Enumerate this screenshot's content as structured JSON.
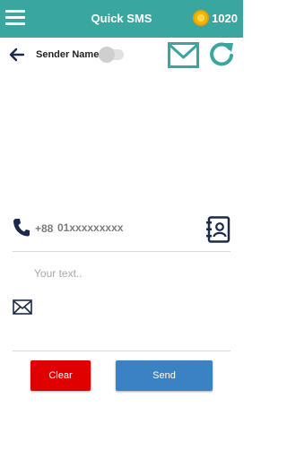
{
  "appbar": {
    "title": "Quick SMS",
    "coins": "1020",
    "background": "#3aa6a0"
  },
  "icons": {
    "menu": "menu-icon",
    "coin": "coin-icon",
    "back": "back-arrow-icon",
    "mail": "mail-icon",
    "refresh": "refresh-icon",
    "phone": "phone-icon",
    "contacts": "contacts-book-icon",
    "message": "envelope-icon"
  },
  "sender": {
    "label": "Sender Name:",
    "enabled": false
  },
  "recipient": {
    "country_code": "+88",
    "placeholder": "01xxxxxxxxx",
    "value": ""
  },
  "message": {
    "placeholder": "Your text..",
    "value": ""
  },
  "actions": {
    "clear_label": "Clear",
    "send_label": "Send",
    "clear_color": "#e00000",
    "send_color": "#3b82c4"
  }
}
